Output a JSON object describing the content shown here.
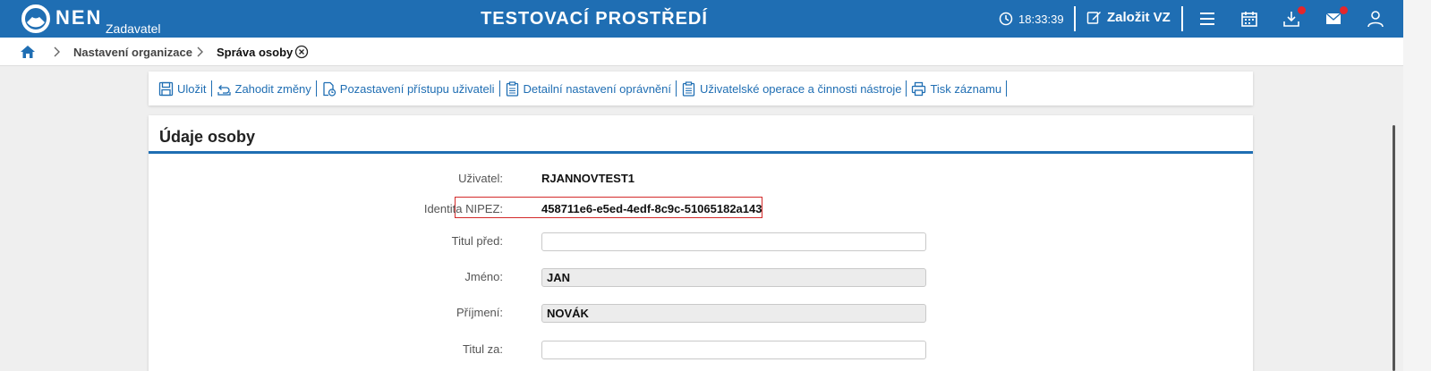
{
  "header": {
    "brand": "NEN",
    "brand_sub": "Zadavatel",
    "env_title": "TESTOVACÍ PROSTŘEDÍ",
    "clock": "18:33:39",
    "create_vz_label": "Založit VZ",
    "accent_color": "#1f6eb3",
    "notification_dot_color": "#e5262b"
  },
  "breadcrumb": {
    "items": [
      "Nastavení organizace",
      "Správa osoby"
    ]
  },
  "toolbar": {
    "save": "Uložit",
    "discard": "Zahodit změny",
    "suspend": "Pozastavení přístupu uživateli",
    "permissions": "Detailní nastavení oprávnění",
    "operations": "Uživatelské operace a činnosti nástroje",
    "print": "Tisk záznamu"
  },
  "panel": {
    "title": "Údaje osoby",
    "fields": {
      "user_label": "Uživatel:",
      "user_value": "RJANNOVTEST1",
      "identity_label": "Identita NIPEZ:",
      "identity_value": "458711e6-e5ed-4edf-8c9c-51065182a143",
      "title_before_label": "Titul před:",
      "title_before_value": "",
      "first_name_label": "Jméno:",
      "first_name_value": "JAN",
      "last_name_label": "Příjmení:",
      "last_name_value": "NOVÁK",
      "title_after_label": "Titul za:",
      "title_after_value": ""
    }
  }
}
